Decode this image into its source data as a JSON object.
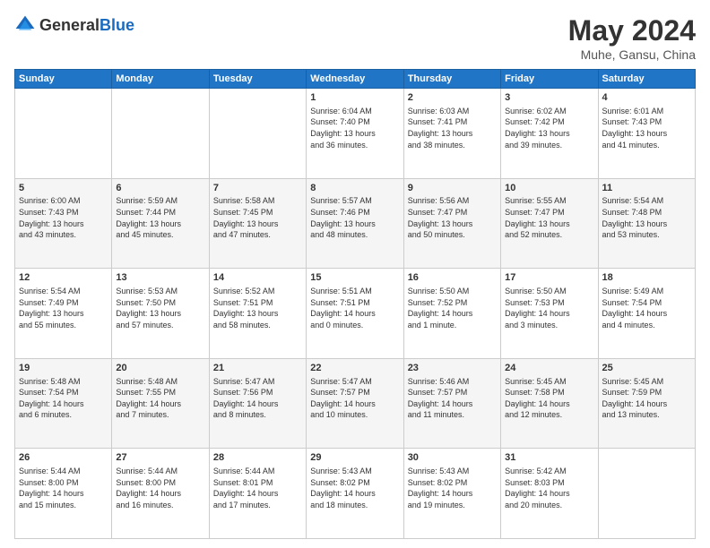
{
  "header": {
    "logo_general": "General",
    "logo_blue": "Blue",
    "month": "May 2024",
    "location": "Muhe, Gansu, China"
  },
  "days_of_week": [
    "Sunday",
    "Monday",
    "Tuesday",
    "Wednesday",
    "Thursday",
    "Friday",
    "Saturday"
  ],
  "weeks": [
    [
      {
        "day": "",
        "content": ""
      },
      {
        "day": "",
        "content": ""
      },
      {
        "day": "",
        "content": ""
      },
      {
        "day": "1",
        "content": "Sunrise: 6:04 AM\nSunset: 7:40 PM\nDaylight: 13 hours\nand 36 minutes."
      },
      {
        "day": "2",
        "content": "Sunrise: 6:03 AM\nSunset: 7:41 PM\nDaylight: 13 hours\nand 38 minutes."
      },
      {
        "day": "3",
        "content": "Sunrise: 6:02 AM\nSunset: 7:42 PM\nDaylight: 13 hours\nand 39 minutes."
      },
      {
        "day": "4",
        "content": "Sunrise: 6:01 AM\nSunset: 7:43 PM\nDaylight: 13 hours\nand 41 minutes."
      }
    ],
    [
      {
        "day": "5",
        "content": "Sunrise: 6:00 AM\nSunset: 7:43 PM\nDaylight: 13 hours\nand 43 minutes."
      },
      {
        "day": "6",
        "content": "Sunrise: 5:59 AM\nSunset: 7:44 PM\nDaylight: 13 hours\nand 45 minutes."
      },
      {
        "day": "7",
        "content": "Sunrise: 5:58 AM\nSunset: 7:45 PM\nDaylight: 13 hours\nand 47 minutes."
      },
      {
        "day": "8",
        "content": "Sunrise: 5:57 AM\nSunset: 7:46 PM\nDaylight: 13 hours\nand 48 minutes."
      },
      {
        "day": "9",
        "content": "Sunrise: 5:56 AM\nSunset: 7:47 PM\nDaylight: 13 hours\nand 50 minutes."
      },
      {
        "day": "10",
        "content": "Sunrise: 5:55 AM\nSunset: 7:47 PM\nDaylight: 13 hours\nand 52 minutes."
      },
      {
        "day": "11",
        "content": "Sunrise: 5:54 AM\nSunset: 7:48 PM\nDaylight: 13 hours\nand 53 minutes."
      }
    ],
    [
      {
        "day": "12",
        "content": "Sunrise: 5:54 AM\nSunset: 7:49 PM\nDaylight: 13 hours\nand 55 minutes."
      },
      {
        "day": "13",
        "content": "Sunrise: 5:53 AM\nSunset: 7:50 PM\nDaylight: 13 hours\nand 57 minutes."
      },
      {
        "day": "14",
        "content": "Sunrise: 5:52 AM\nSunset: 7:51 PM\nDaylight: 13 hours\nand 58 minutes."
      },
      {
        "day": "15",
        "content": "Sunrise: 5:51 AM\nSunset: 7:51 PM\nDaylight: 14 hours\nand 0 minutes."
      },
      {
        "day": "16",
        "content": "Sunrise: 5:50 AM\nSunset: 7:52 PM\nDaylight: 14 hours\nand 1 minute."
      },
      {
        "day": "17",
        "content": "Sunrise: 5:50 AM\nSunset: 7:53 PM\nDaylight: 14 hours\nand 3 minutes."
      },
      {
        "day": "18",
        "content": "Sunrise: 5:49 AM\nSunset: 7:54 PM\nDaylight: 14 hours\nand 4 minutes."
      }
    ],
    [
      {
        "day": "19",
        "content": "Sunrise: 5:48 AM\nSunset: 7:54 PM\nDaylight: 14 hours\nand 6 minutes."
      },
      {
        "day": "20",
        "content": "Sunrise: 5:48 AM\nSunset: 7:55 PM\nDaylight: 14 hours\nand 7 minutes."
      },
      {
        "day": "21",
        "content": "Sunrise: 5:47 AM\nSunset: 7:56 PM\nDaylight: 14 hours\nand 8 minutes."
      },
      {
        "day": "22",
        "content": "Sunrise: 5:47 AM\nSunset: 7:57 PM\nDaylight: 14 hours\nand 10 minutes."
      },
      {
        "day": "23",
        "content": "Sunrise: 5:46 AM\nSunset: 7:57 PM\nDaylight: 14 hours\nand 11 minutes."
      },
      {
        "day": "24",
        "content": "Sunrise: 5:45 AM\nSunset: 7:58 PM\nDaylight: 14 hours\nand 12 minutes."
      },
      {
        "day": "25",
        "content": "Sunrise: 5:45 AM\nSunset: 7:59 PM\nDaylight: 14 hours\nand 13 minutes."
      }
    ],
    [
      {
        "day": "26",
        "content": "Sunrise: 5:44 AM\nSunset: 8:00 PM\nDaylight: 14 hours\nand 15 minutes."
      },
      {
        "day": "27",
        "content": "Sunrise: 5:44 AM\nSunset: 8:00 PM\nDaylight: 14 hours\nand 16 minutes."
      },
      {
        "day": "28",
        "content": "Sunrise: 5:44 AM\nSunset: 8:01 PM\nDaylight: 14 hours\nand 17 minutes."
      },
      {
        "day": "29",
        "content": "Sunrise: 5:43 AM\nSunset: 8:02 PM\nDaylight: 14 hours\nand 18 minutes."
      },
      {
        "day": "30",
        "content": "Sunrise: 5:43 AM\nSunset: 8:02 PM\nDaylight: 14 hours\nand 19 minutes."
      },
      {
        "day": "31",
        "content": "Sunrise: 5:42 AM\nSunset: 8:03 PM\nDaylight: 14 hours\nand 20 minutes."
      },
      {
        "day": "",
        "content": ""
      }
    ]
  ]
}
